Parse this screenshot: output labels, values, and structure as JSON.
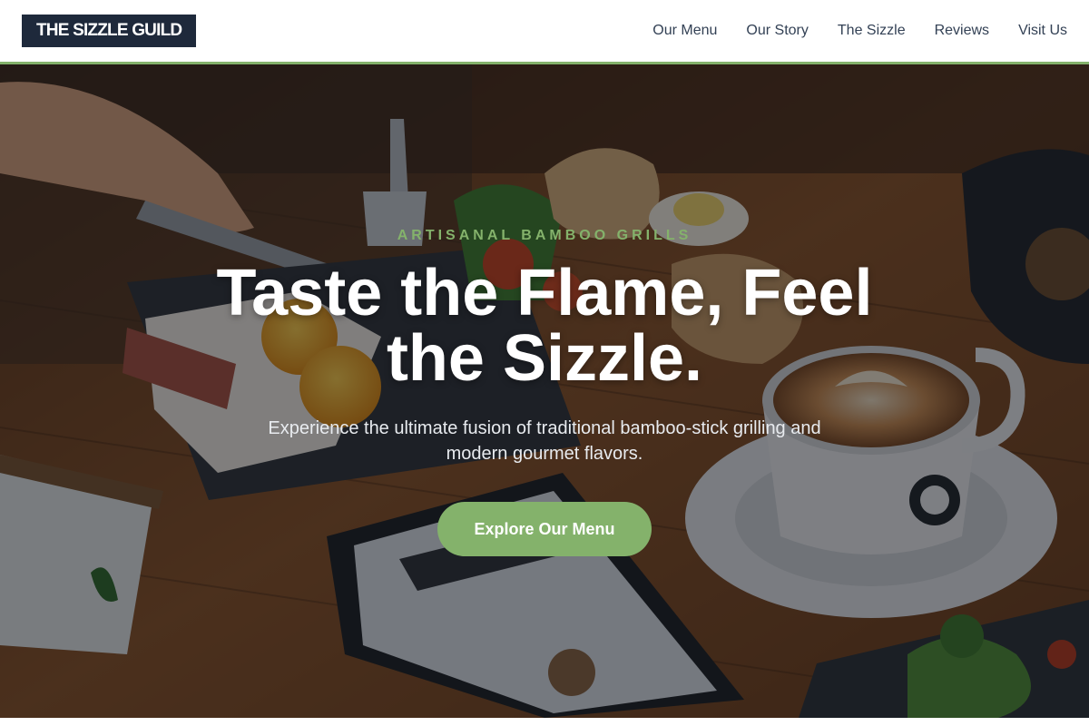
{
  "brand": {
    "logo_text": "THE SIZZLE GUILD"
  },
  "nav": {
    "items": [
      {
        "label": "Our Menu"
      },
      {
        "label": "Our Story"
      },
      {
        "label": "The Sizzle"
      },
      {
        "label": "Reviews"
      },
      {
        "label": "Visit Us"
      }
    ]
  },
  "hero": {
    "eyebrow": "ARTISANAL BAMBOO GRILLS",
    "headline": "Taste the Flame, Feel the Sizzle.",
    "subtitle": "Experience the ultimate fusion of traditional bamboo-stick grilling and modern gourmet flavors.",
    "cta_label": "Explore Our Menu",
    "background_image": "breakfast-table-photo"
  },
  "colors": {
    "accent": "#84b26b",
    "logo_bg": "#1e293b",
    "nav_text": "#334155"
  }
}
